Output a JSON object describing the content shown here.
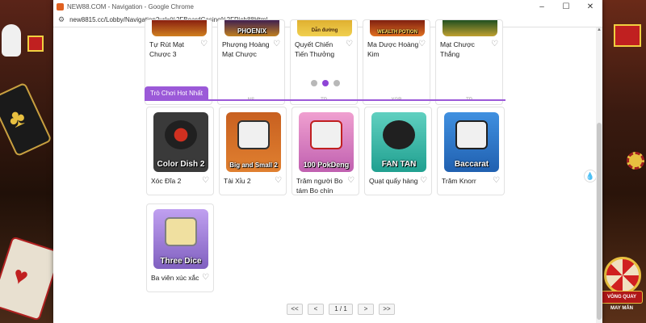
{
  "browser": {
    "title": "NEW88.COM - Navigation - Google Chrome",
    "url": "new8815.cc/Lobby/Navigation?url=%2FBoardCasino%2FRich88Html",
    "controls": [
      "–",
      "☐",
      "✕"
    ]
  },
  "top_games": [
    {
      "name": "Tự Rút Mạt Chược 3",
      "provider": "VA",
      "art_label": ""
    },
    {
      "name": "Phượng Hoàng Mạt Chược",
      "provider": "NS",
      "art_label": "PHOENIX"
    },
    {
      "name": "Quyết Chiến Tiến Thưởng",
      "provider": "TP",
      "art_label": "Dẫn đường"
    },
    {
      "name": "Ma Dược Hoàng Kim",
      "provider": "YGR",
      "art_label": "WEALTH POTION"
    },
    {
      "name": "Mạt Chược Thắng",
      "provider": "TP",
      "art_label": ""
    }
  ],
  "carousel": {
    "count": 3,
    "active": 1
  },
  "section": {
    "title": "Trò Chơi Hot Nhất"
  },
  "hot_games": [
    {
      "name": "Xóc Đĩa 2",
      "art_label": "Color Dish 2",
      "bg": "#3a3a3a",
      "art": "#d03020"
    },
    {
      "name": "Tài Xỉu 2",
      "art_label": "Big and Small 2",
      "bg": "#c86020",
      "art": "#f0f0f0"
    },
    {
      "name": "Trăm người Bo tám Bo chín",
      "art_label": "100 PokDeng",
      "bg": "#e080c0",
      "art": "#f0f0f0"
    },
    {
      "name": "Quạt quẩy hàng",
      "art_label": "FAN TAN",
      "bg": "#30b0a0",
      "art": "#202020"
    },
    {
      "name": "Trăm Knorr",
      "art_label": "Baccarat",
      "bg": "#3070c0",
      "art": "#f0f0f0"
    },
    {
      "name": "Ba viên xúc xắc",
      "art_label": "Three Dice",
      "bg": "#a070d0",
      "art": "#f0e0a0"
    }
  ],
  "pager": {
    "first": "<<",
    "prev": "<",
    "info": "1 / 1",
    "next": ">",
    "last": ">>"
  },
  "promo": {
    "wheel_label": "VÒNG QUAY MAY MẮN"
  },
  "colors": {
    "accent": "#9b59d8",
    "active_dot": "#8e44d6"
  }
}
